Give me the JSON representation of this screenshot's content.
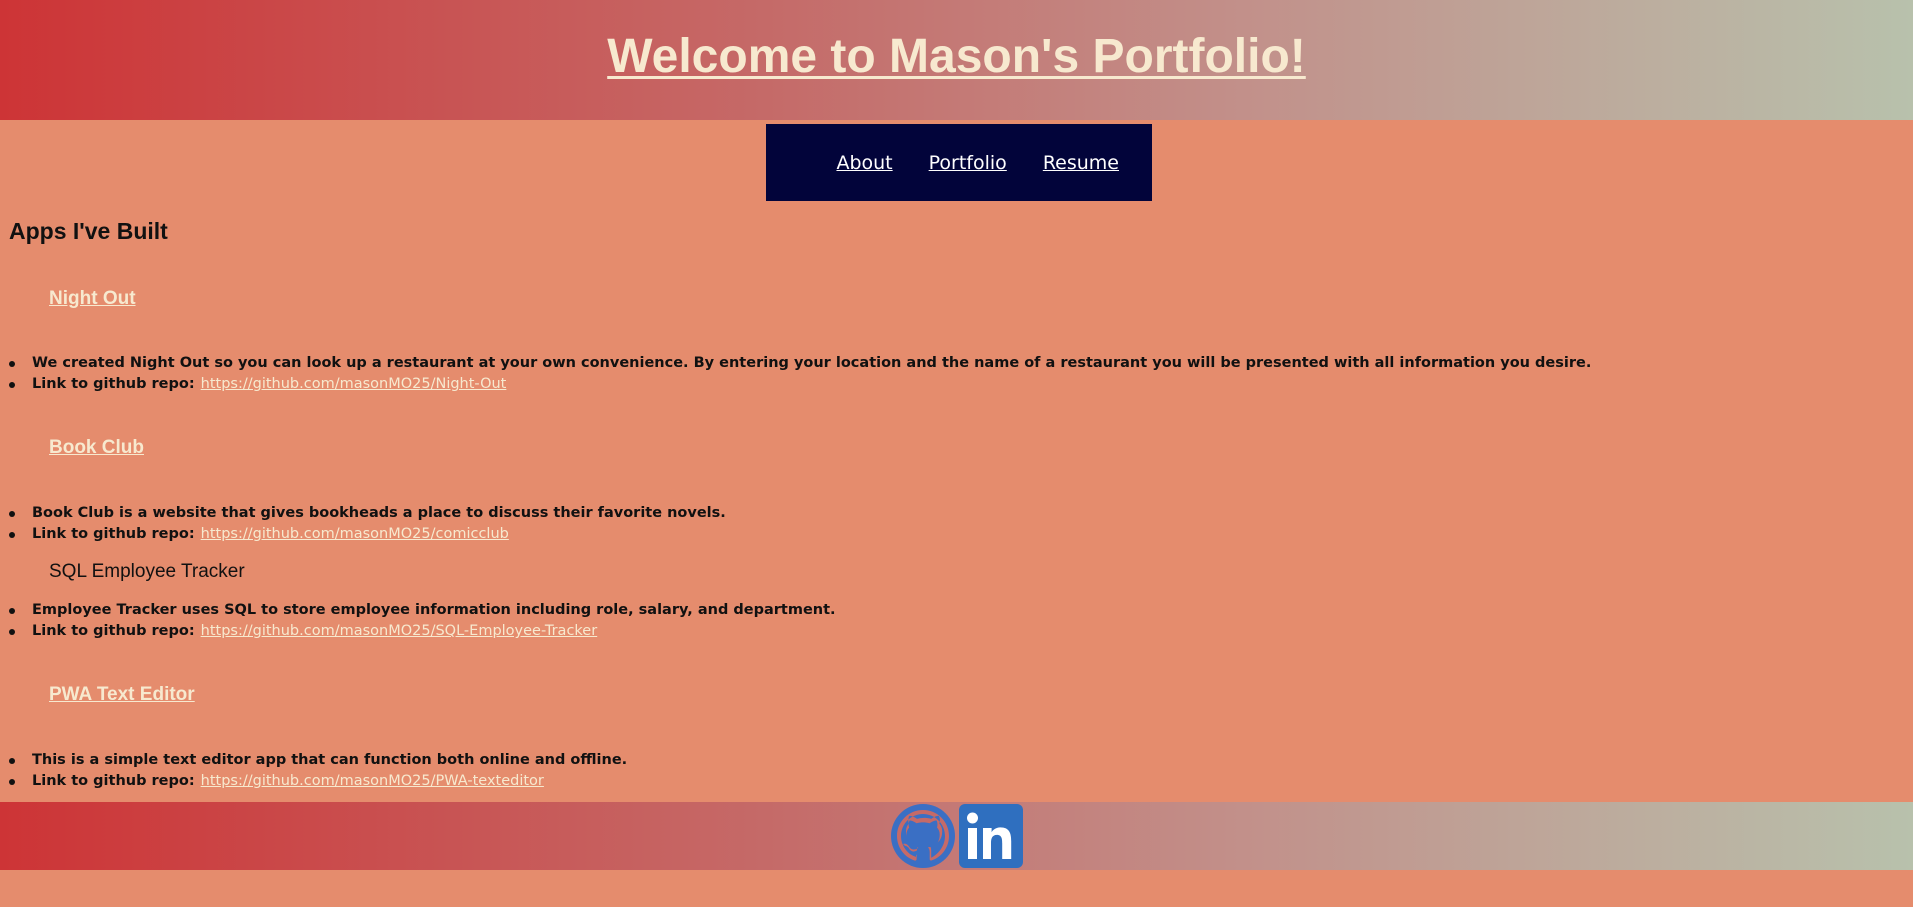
{
  "header": {
    "title": "Welcome to Mason's Portfolio!"
  },
  "nav": {
    "items": [
      {
        "label": "About"
      },
      {
        "label": "Portfolio"
      },
      {
        "label": "Resume"
      }
    ]
  },
  "main": {
    "section_title": "Apps I've Built",
    "apps": [
      {
        "title": "Night Out",
        "description": "We created Night Out so you can look up a restaurant at your own convenience. By entering your location and the name of a restaurant you will be presented with all information you desire.",
        "link_label": "Link to github repo:",
        "link": "https://github.com/masonMO25/Night-Out"
      },
      {
        "title": "Book Club",
        "description": "Book Club is a website that gives bookheads a place to discuss their favorite novels.",
        "link_label": "Link to github repo:",
        "link": "https://github.com/masonMO25/comicclub"
      },
      {
        "title": "SQL Employee Tracker",
        "description": "Employee Tracker uses SQL to store employee information including role, salary, and department.",
        "link_label": "Link to github repo:",
        "link": "https://github.com/masonMO25/SQL-Employee-Tracker"
      },
      {
        "title": "PWA Text Editor",
        "description": "This is a simple text editor app that can function both online and offline.",
        "link_label": "Link to github repo:",
        "link": "https://github.com/masonMO25/PWA-texteditor"
      }
    ]
  },
  "footer": {
    "icons": [
      {
        "name": "github-icon",
        "color": "#3a6fc4"
      },
      {
        "name": "linkedin-icon",
        "color": "#2f6fbf"
      }
    ]
  },
  "colors": {
    "background": "#e58c6d",
    "nav_background": "#02043a",
    "gradient_start": "#cd3436",
    "gradient_end": "#b8c1ac",
    "link_text": "#f7e9cf"
  }
}
